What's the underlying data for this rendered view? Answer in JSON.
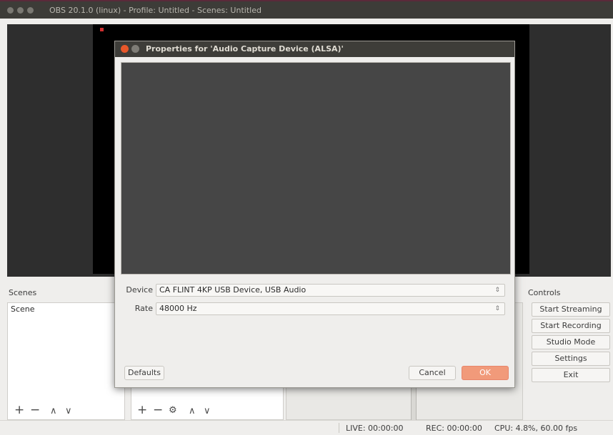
{
  "window": {
    "title": "OBS 20.1.0 (linux) - Profile: Untitled - Scenes: Untitled"
  },
  "scenes": {
    "title": "Scenes",
    "items": [
      "Scene"
    ],
    "toolbar": {
      "add": "+",
      "remove": "−",
      "up": "∧",
      "down": "∨"
    }
  },
  "sources": {
    "toolbar": {
      "add": "+",
      "remove": "−",
      "settings": "⚙",
      "up": "∧",
      "down": "∨"
    }
  },
  "controls": {
    "title": "Controls",
    "buttons": [
      "Start Streaming",
      "Start Recording",
      "Studio Mode",
      "Settings",
      "Exit"
    ]
  },
  "status": {
    "live": "LIVE: 00:00:00",
    "rec": "REC: 00:00:00",
    "cpu": "CPU: 4.8%, 60.00 fps"
  },
  "dialog": {
    "title": "Properties for 'Audio Capture Device (ALSA)'",
    "device_label": "Device",
    "device_value": "CA FLINT 4KP USB Device, USB Audio",
    "rate_label": "Rate",
    "rate_value": "48000 Hz",
    "defaults_button": "Defaults",
    "cancel_button": "Cancel",
    "ok_button": "OK"
  },
  "colors": {
    "ok_button": "#f19a7a",
    "close_button": "#e8572a",
    "titlebar": "#3d3c38"
  }
}
